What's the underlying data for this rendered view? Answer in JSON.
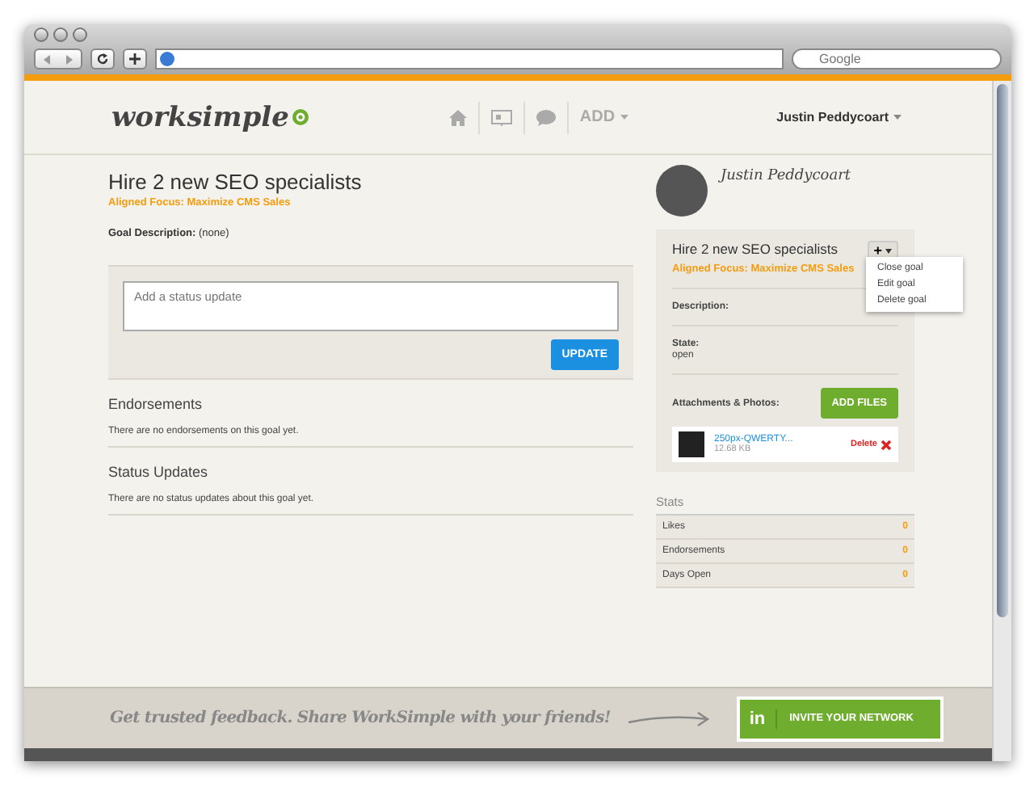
{
  "browser": {
    "search_placeholder": "Google"
  },
  "header": {
    "logo": "worksimple",
    "nav": [
      {
        "kind": "home"
      },
      {
        "kind": "presentation"
      },
      {
        "kind": "chat"
      },
      {
        "kind": "add",
        "label": "ADD"
      }
    ],
    "user": "Justin Peddycoart"
  },
  "goal": {
    "title": "Hire 2 new SEO specialists",
    "focus": "Aligned Focus: Maximize CMS Sales",
    "description_label": "Goal Description:",
    "description_value": "(none)"
  },
  "status_form": {
    "placeholder": "Add a status update",
    "button": "UPDATE"
  },
  "sections": [
    {
      "title": "Endorsements",
      "text": "There are no endorsements on this goal yet."
    },
    {
      "title": "Status Updates",
      "text": "There are no status updates about this goal yet."
    }
  ],
  "sidebar": {
    "owner": "Justin Peddycoart",
    "title": "Hire 2 new SEO specialists",
    "focus": "Aligned Focus: Maximize CMS Sales",
    "menu_button": "+",
    "menu": {
      "expanded": true,
      "items": [
        "Close goal",
        "Edit goal",
        "Delete goal"
      ]
    },
    "description_label": "Description:",
    "state_label": "State:",
    "state_value": "open",
    "attachments_label": "Attachments & Photos:",
    "add_files": "ADD FILES",
    "files": [
      {
        "name": "250px-QWERTY...",
        "size": "12.68 KB",
        "delete": "Delete"
      }
    ]
  },
  "stats": {
    "title": "Stats",
    "rows": [
      {
        "label": "Likes",
        "value": "0"
      },
      {
        "label": "Endorsements",
        "value": "0"
      },
      {
        "label": "Days Open",
        "value": "0"
      }
    ]
  },
  "footer": {
    "message": "Get trusted feedback. Share WorkSimple with your friends!",
    "button_logo": "in",
    "button": "INVITE YOUR NETWORK"
  }
}
